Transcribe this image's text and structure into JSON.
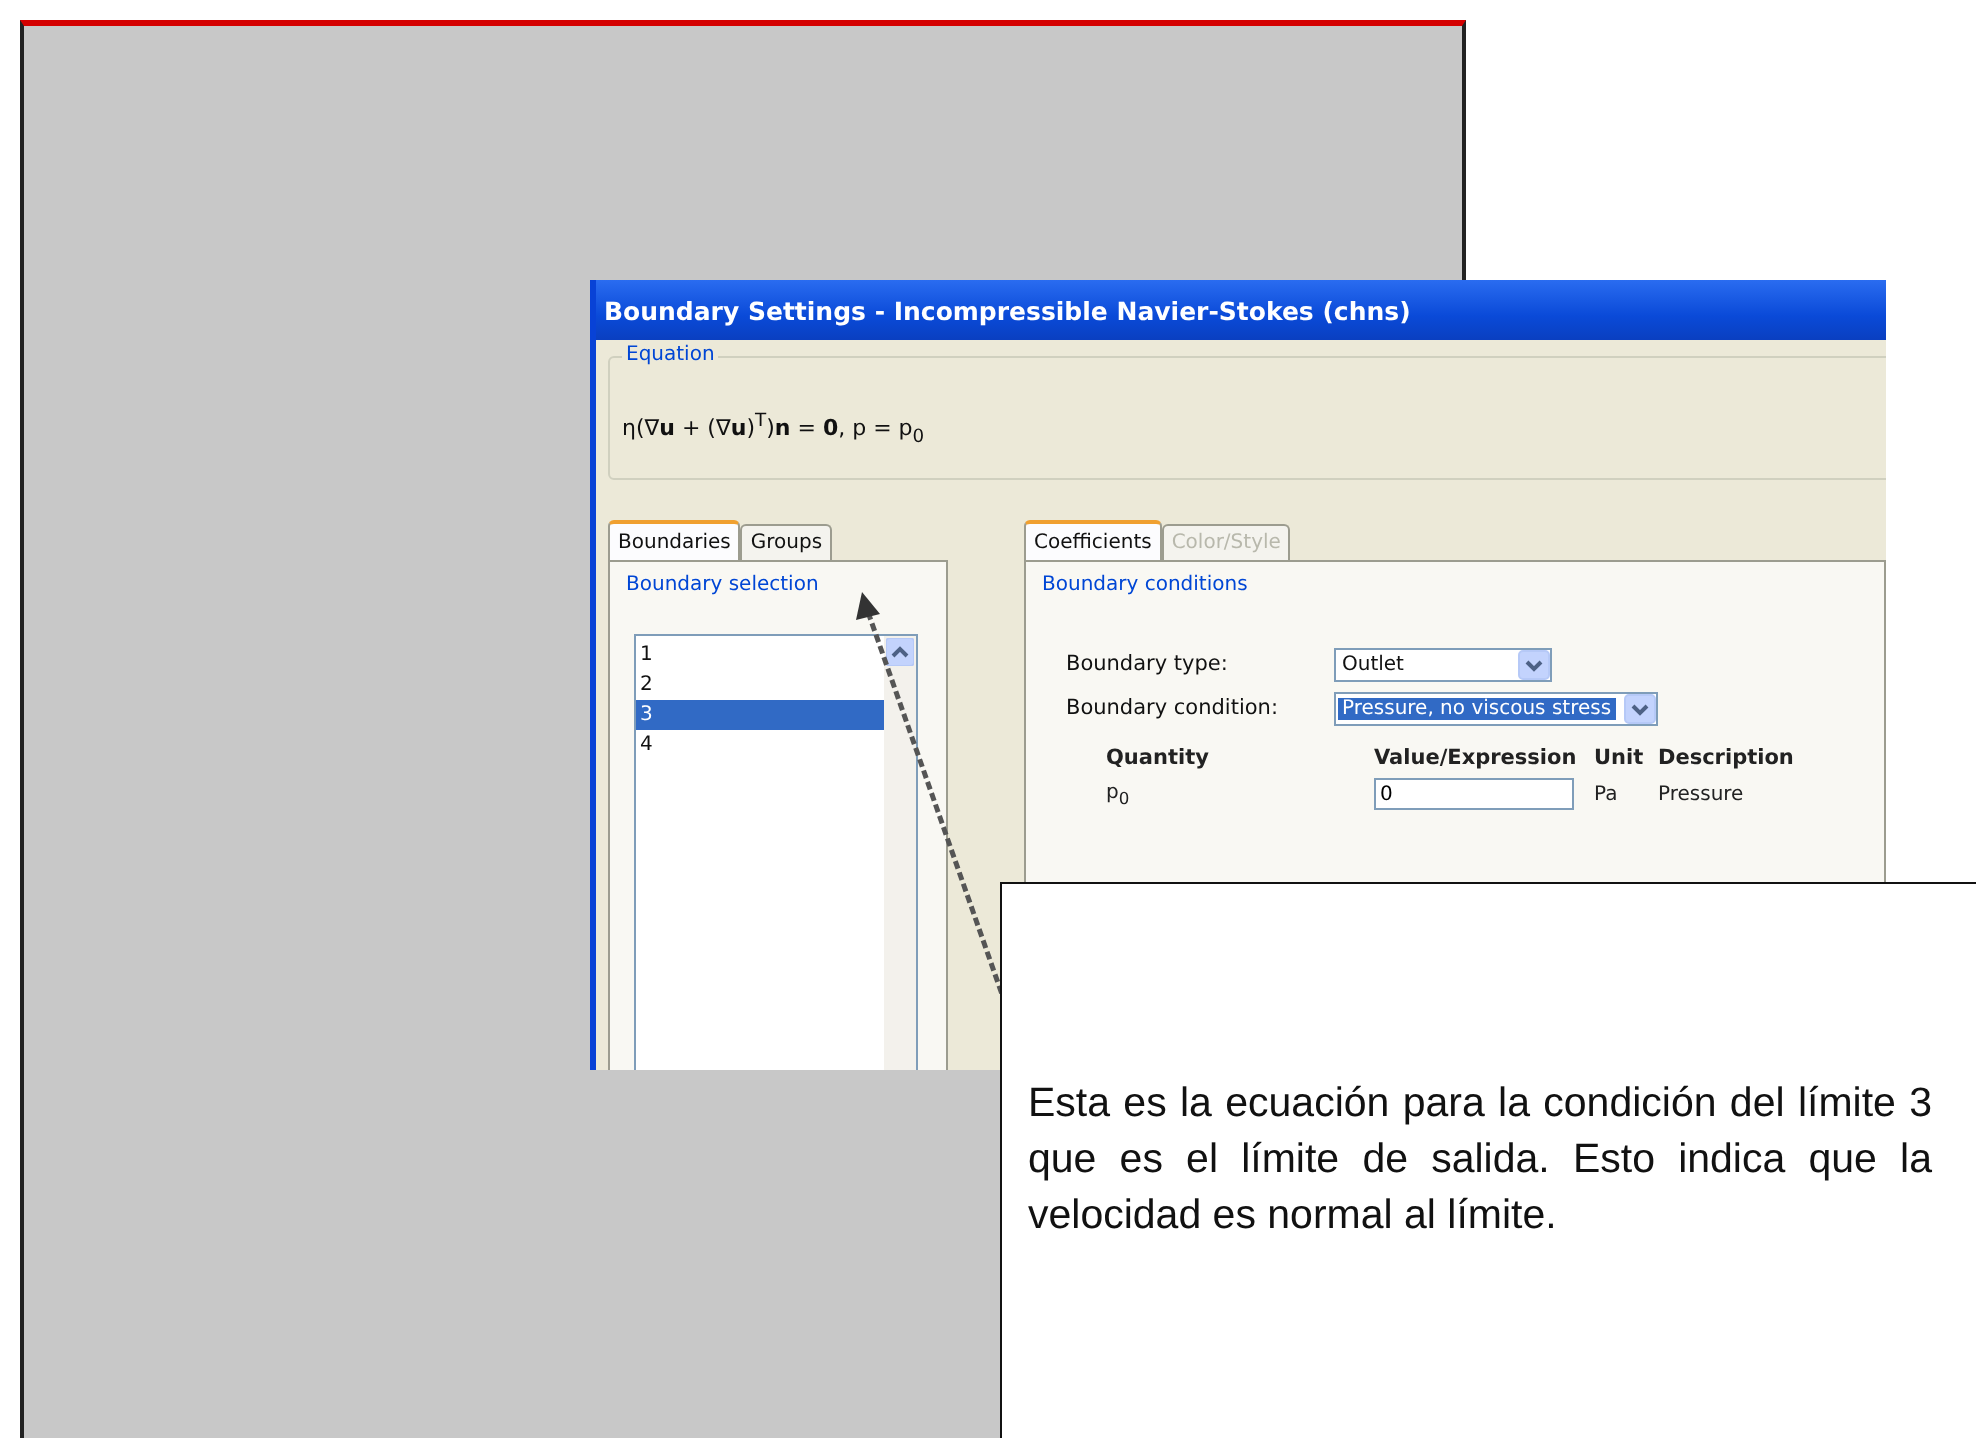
{
  "dialog": {
    "title": "Boundary Settings - Incompressible Navier-Stokes (chns)",
    "equation": {
      "label": "Equation",
      "text": "η(∇**u** + (∇**u**)$^{T}$)**n** = **0**, p = p$_{0}$"
    },
    "left_tabs": [
      {
        "label": "Boundaries",
        "selected": true
      },
      {
        "label": "Groups",
        "selected": false
      }
    ],
    "boundary_selection": {
      "label": "Boundary selection",
      "items": [
        {
          "label": "1",
          "selected": false
        },
        {
          "label": "2",
          "selected": false
        },
        {
          "label": "3",
          "selected": true
        },
        {
          "label": "4",
          "selected": false
        }
      ]
    },
    "right_tabs": [
      {
        "label": "Coefficients",
        "selected": true,
        "disabled": false
      },
      {
        "label": "Color/Style",
        "selected": false,
        "disabled": true
      }
    ],
    "boundary_conditions": {
      "label": "Boundary conditions",
      "fields": [
        {
          "label": "Boundary type:",
          "value": "Outlet",
          "highlighted": false
        },
        {
          "label": "Boundary condition:",
          "value": "Pressure, no viscous stress",
          "highlighted": true
        }
      ],
      "columns": [
        "Quantity",
        "Value/Expression",
        "Unit",
        "Description"
      ],
      "rows": [
        {
          "quantity": "p$_{0}$",
          "value": "0",
          "unit": "Pa",
          "description": "Pressure"
        }
      ]
    }
  },
  "callout": {
    "text": "Esta es la ecuación para la condición del límite 3 que es el límite de salida. Esto indica que la velocidad es normal al límite."
  }
}
